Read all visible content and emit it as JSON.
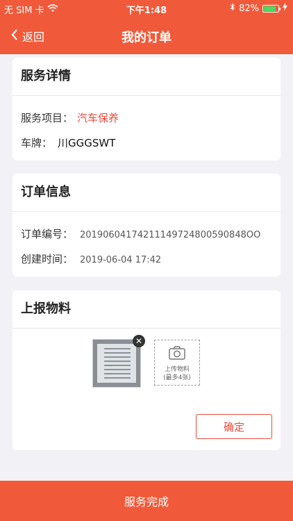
{
  "status_bar": {
    "carrier": "无 SIM 卡",
    "time": "下午1:48",
    "battery_percent": "82%",
    "battery_level": 0.82
  },
  "nav": {
    "back_label": "返回",
    "title": "我的订单"
  },
  "service_details": {
    "title": "服务详情",
    "item_label": "服务项目：",
    "item_value": "汽车保养",
    "plate_label": "车牌：",
    "plate_value": "川GGGSWT"
  },
  "order_info": {
    "title": "订单信息",
    "number_label": "订单编号：",
    "number_value": "20190604174211149724800590848OO",
    "created_label": "创建时间：",
    "created_value": "2019-06-04 17:42"
  },
  "materials": {
    "title": "上报物料",
    "upload_label": "上传物料",
    "upload_hint": "(最多4张)",
    "confirm_label": "确定"
  },
  "bottom": {
    "complete_label": "服务完成"
  },
  "colors": {
    "brand": "#f05a3a",
    "accent_red": "#e64a3a"
  }
}
